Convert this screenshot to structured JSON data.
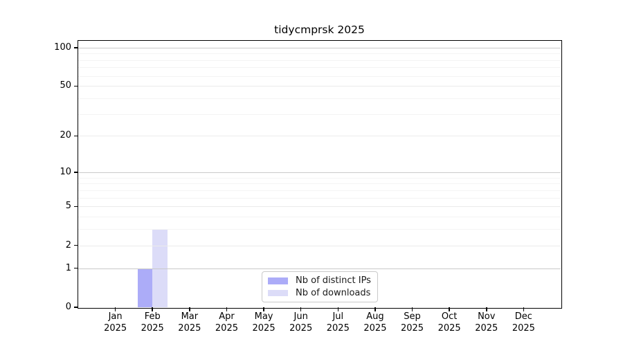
{
  "title": "tidycmprsk 2025",
  "chart_data": {
    "type": "bar",
    "title": "tidycmprsk 2025",
    "x_tick_labels": [
      [
        "Jan",
        "2025"
      ],
      [
        "Feb",
        "2025"
      ],
      [
        "Mar",
        "2025"
      ],
      [
        "Apr",
        "2025"
      ],
      [
        "May",
        "2025"
      ],
      [
        "Jun",
        "2025"
      ],
      [
        "Jul",
        "2025"
      ],
      [
        "Aug",
        "2025"
      ],
      [
        "Sep",
        "2025"
      ],
      [
        "Oct",
        "2025"
      ],
      [
        "Nov",
        "2025"
      ],
      [
        "Dec",
        "2025"
      ]
    ],
    "series": [
      {
        "name": "Nb of distinct IPs",
        "color": "#acacf8",
        "values": [
          0,
          1,
          0,
          0,
          0,
          0,
          0,
          0,
          0,
          0,
          0,
          0
        ]
      },
      {
        "name": "Nb of downloads",
        "color": "#dcdcf8",
        "values": [
          0,
          3,
          0,
          0,
          0,
          0,
          0,
          0,
          0,
          0,
          0,
          0
        ]
      }
    ],
    "y_axis": {
      "scale": "log1p",
      "major_ticks": [
        0,
        1,
        2,
        5,
        10,
        20,
        50,
        100
      ],
      "minor_gridline_values": [
        3,
        4,
        6,
        7,
        8,
        9,
        30,
        40,
        60,
        70,
        80,
        90
      ],
      "ylim": [
        0,
        100
      ]
    },
    "legend": {
      "position": "inside-bottom-center",
      "entries": [
        "Nb of distinct IPs",
        "Nb of downloads"
      ]
    },
    "grid": true,
    "colors": {
      "spine": "#000000",
      "grid_decade": "#c9c9c9",
      "grid_major": "#ebebeb",
      "grid_minor": "#f4f4f4",
      "background": "#ffffff",
      "text": "#000000"
    }
  }
}
